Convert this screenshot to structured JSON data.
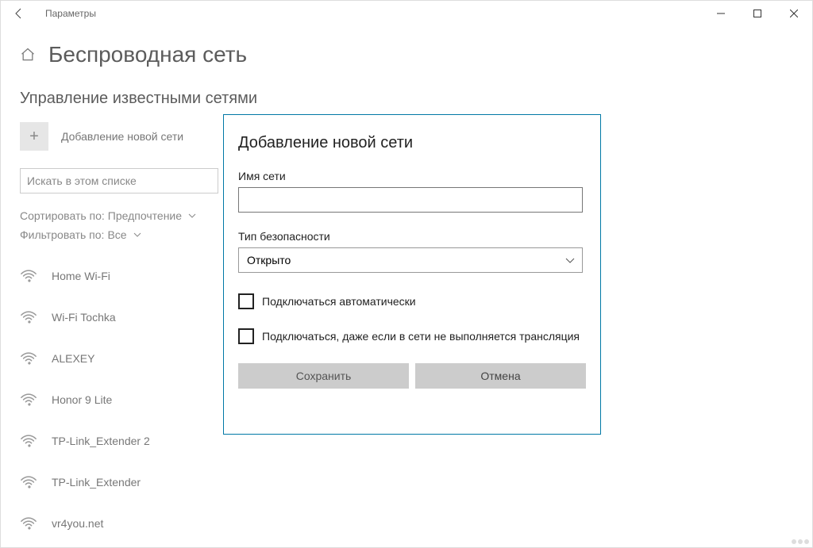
{
  "titlebar": {
    "title": "Параметры"
  },
  "page": {
    "heading": "Беспроводная сеть",
    "subheading": "Управление известными сетями",
    "add_label": "Добавление новой сети",
    "search_placeholder": "Искать в этом списке",
    "sort_label": "Сортировать по:",
    "sort_value": "Предпочтение",
    "filter_label": "Фильтровать по:",
    "filter_value": "Все"
  },
  "networks": [
    {
      "name": "Home Wi-Fi"
    },
    {
      "name": "Wi-Fi Tochka"
    },
    {
      "name": "ALEXEY"
    },
    {
      "name": "Honor 9 Lite"
    },
    {
      "name": "TP-Link_Extender 2"
    },
    {
      "name": "TP-Link_Extender"
    },
    {
      "name": "vr4you.net"
    }
  ],
  "dialog": {
    "title": "Добавление новой сети",
    "name_label": "Имя сети",
    "name_value": "",
    "security_label": "Тип безопасности",
    "security_value": "Открыто",
    "auto_connect": "Подключаться автоматически",
    "connect_hidden": "Подключаться, даже если в сети не выполняется трансляция",
    "save": "Сохранить",
    "cancel": "Отмена"
  }
}
